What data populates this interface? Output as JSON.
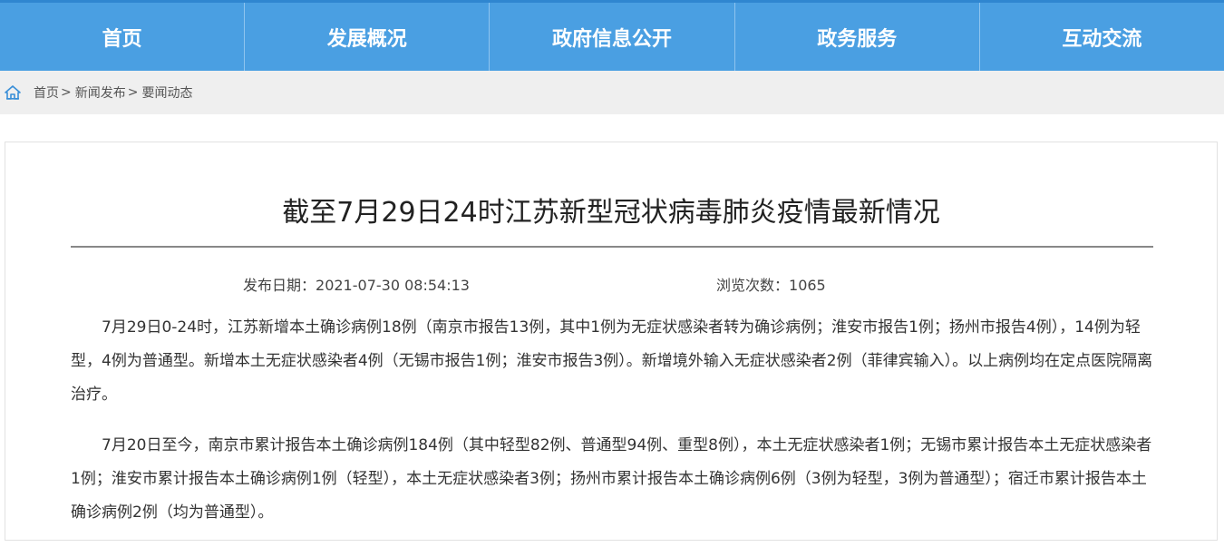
{
  "nav": {
    "items": [
      {
        "label": "首页"
      },
      {
        "label": "发展概况"
      },
      {
        "label": "政府信息公开"
      },
      {
        "label": "政务服务"
      },
      {
        "label": "互动交流"
      }
    ]
  },
  "breadcrumb": {
    "items": [
      "首页",
      "新闻发布",
      "要闻动态"
    ],
    "separator": ">"
  },
  "article": {
    "title": "截至7月29日24时江苏新型冠状病毒肺炎疫情最新情况",
    "publish_label": "发布日期：",
    "publish_date": "2021-07-30 08:54:13",
    "views_label": "浏览次数：",
    "views": "1065",
    "paragraphs": [
      "7月29日0-24时，江苏新增本土确诊病例18例（南京市报告13例，其中1例为无症状感染者转为确诊病例；淮安市报告1例；扬州市报告4例），14例为轻型，4例为普通型。新增本土无症状感染者4例（无锡市报告1例；淮安市报告3例）。新增境外输入无症状感染者2例（菲律宾输入）。以上病例均在定点医院隔离治疗。",
      "7月20日至今，南京市累计报告本土确诊病例184例（其中轻型82例、普通型94例、重型8例），本土无症状感染者1例；无锡市累计报告本土无症状感染者1例；淮安市累计报告本土确诊病例1例（轻型），本土无症状感染者3例；扬州市累计报告本土确诊病例6例（3例为轻型，3例为普通型）；宿迁市累计报告本土确诊病例2例（均为普通型）。"
    ]
  },
  "colors": {
    "nav_bg": "#4a9fe2",
    "crumb_bg": "#efefef",
    "home_icon": "#3a8fd8"
  },
  "icons": {
    "home": "home-icon"
  }
}
